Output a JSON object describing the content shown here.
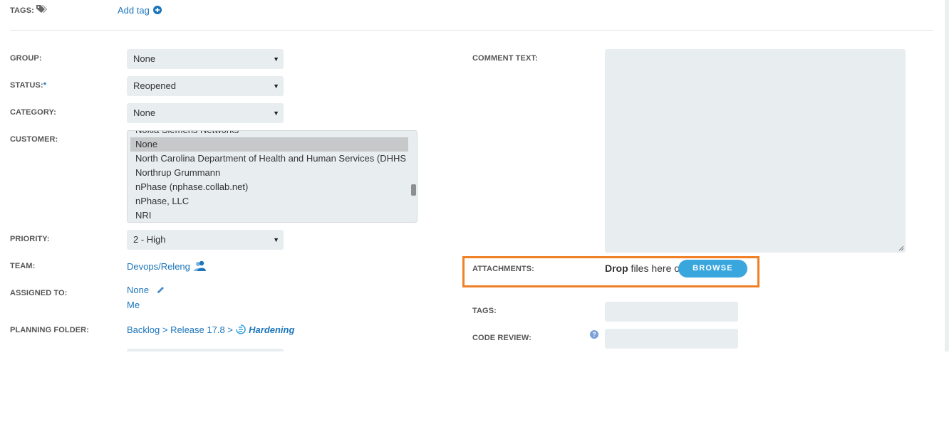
{
  "tags_top": {
    "label": "TAGS:",
    "add_tag": "Add tag"
  },
  "left": {
    "group": {
      "label": "GROUP:",
      "value": "None"
    },
    "status": {
      "label": "STATUS:",
      "required": "*",
      "value": "Reopened"
    },
    "category": {
      "label": "CATEGORY:",
      "value": "None"
    },
    "customer": {
      "label": "CUSTOMER:",
      "options": [
        "Nokia Siemens Networks",
        "None",
        "North Carolina Department of Health and Human Services (DHHS",
        "Northrup Grummann",
        "nPhase (nphase.collab.net)",
        "nPhase, LLC",
        "NRI"
      ],
      "selected": "None"
    },
    "priority": {
      "label": "PRIORITY:",
      "value": "2 - High"
    },
    "team": {
      "label": "TEAM:",
      "value": "Devops/Releng"
    },
    "assigned_to": {
      "label": "ASSIGNED TO:",
      "value": "None",
      "me": "Me"
    },
    "planning_folder": {
      "label": "PLANNING FOLDER:",
      "path": "Backlog > Release 17.8 >",
      "current": "Hardening"
    }
  },
  "right": {
    "comment": {
      "label": "COMMENT TEXT:"
    },
    "attachments": {
      "label": "ATTACHMENTS:",
      "drop_bold": "Drop",
      "drop_rest": " files here or",
      "browse": "BROWSE"
    },
    "tags": {
      "label": "TAGS:"
    },
    "code_review": {
      "label": "CODE REVIEW:",
      "help": "?"
    }
  },
  "colors": {
    "accent": "#1b75bb",
    "highlight": "#f08025",
    "button": "#3aa6de",
    "field_bg": "#e8eef0"
  }
}
